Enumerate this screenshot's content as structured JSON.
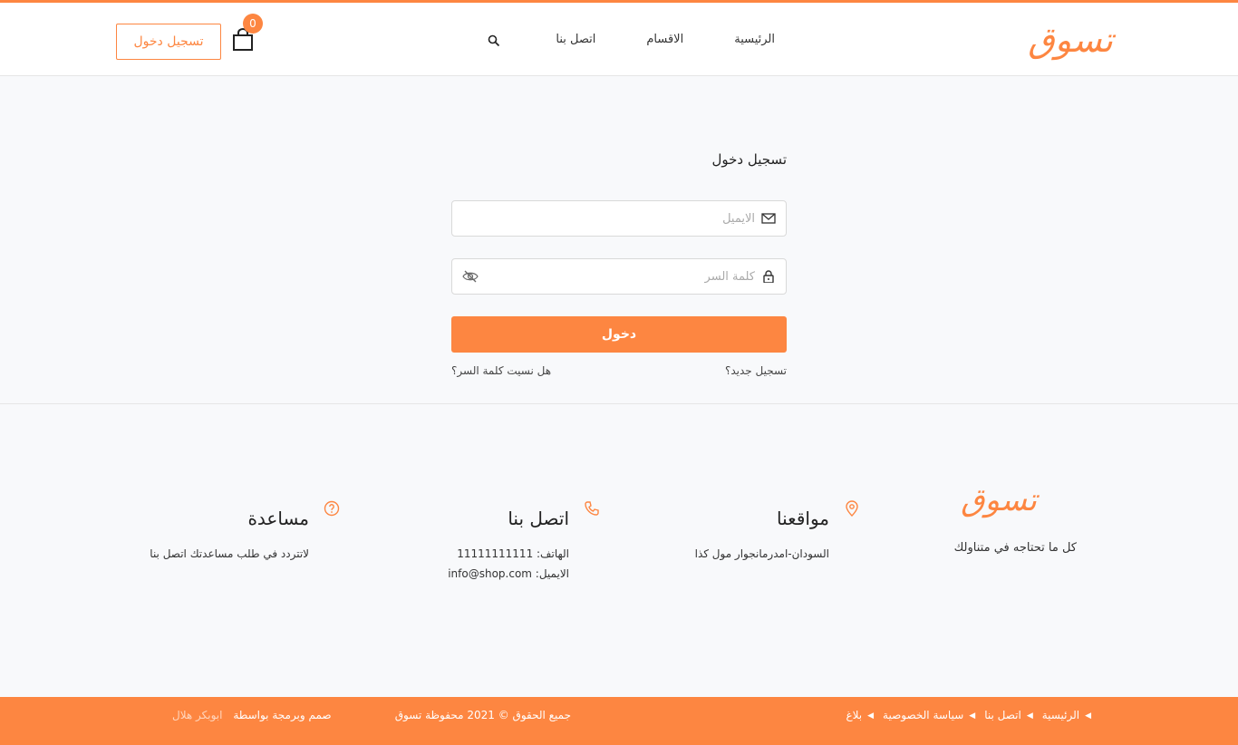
{
  "header": {
    "logo": "تسوق",
    "nav": [
      "الرئيسية",
      "الاقسام",
      "اتصل بنا"
    ],
    "cart_count": "0",
    "login_button": "تسجيل دخول",
    "accent": "#fd8641"
  },
  "login": {
    "title": "تسجيل دخول",
    "email_placeholder": "الايميل",
    "password_placeholder": "كلمة السر",
    "submit": "دخول",
    "register": "تسجيل جديد؟",
    "forgot": "هل نسيت كلمة السر؟"
  },
  "footer": {
    "logo": "تسوق",
    "tagline": "كل ما تحتاجه في متناولك",
    "locations": {
      "title": "مواقعنا",
      "text": "السودان-امدرمانجوار مول كذا",
      "icon": "map-pin-icon"
    },
    "contact": {
      "title": "اتصل بنا",
      "phone": "الهاتف: 11111111111",
      "email": "الايميل: info@shop.com",
      "icon": "phone-icon"
    },
    "help": {
      "title": "مساعدة",
      "text": "لاتتردد في طلب مساعدتك اتصل بنا",
      "icon": "question-icon"
    }
  },
  "bottom": {
    "links": [
      "الرئيسية",
      "اتصل بنا",
      "سياسة الخصوصية",
      "بلاغ"
    ],
    "copyright": "جميع الحقوق © 2021 محفوظة تسوق",
    "credits_label": "صمم وبرمجة بواسطة",
    "credits_author": "ابوبكر هلال"
  }
}
